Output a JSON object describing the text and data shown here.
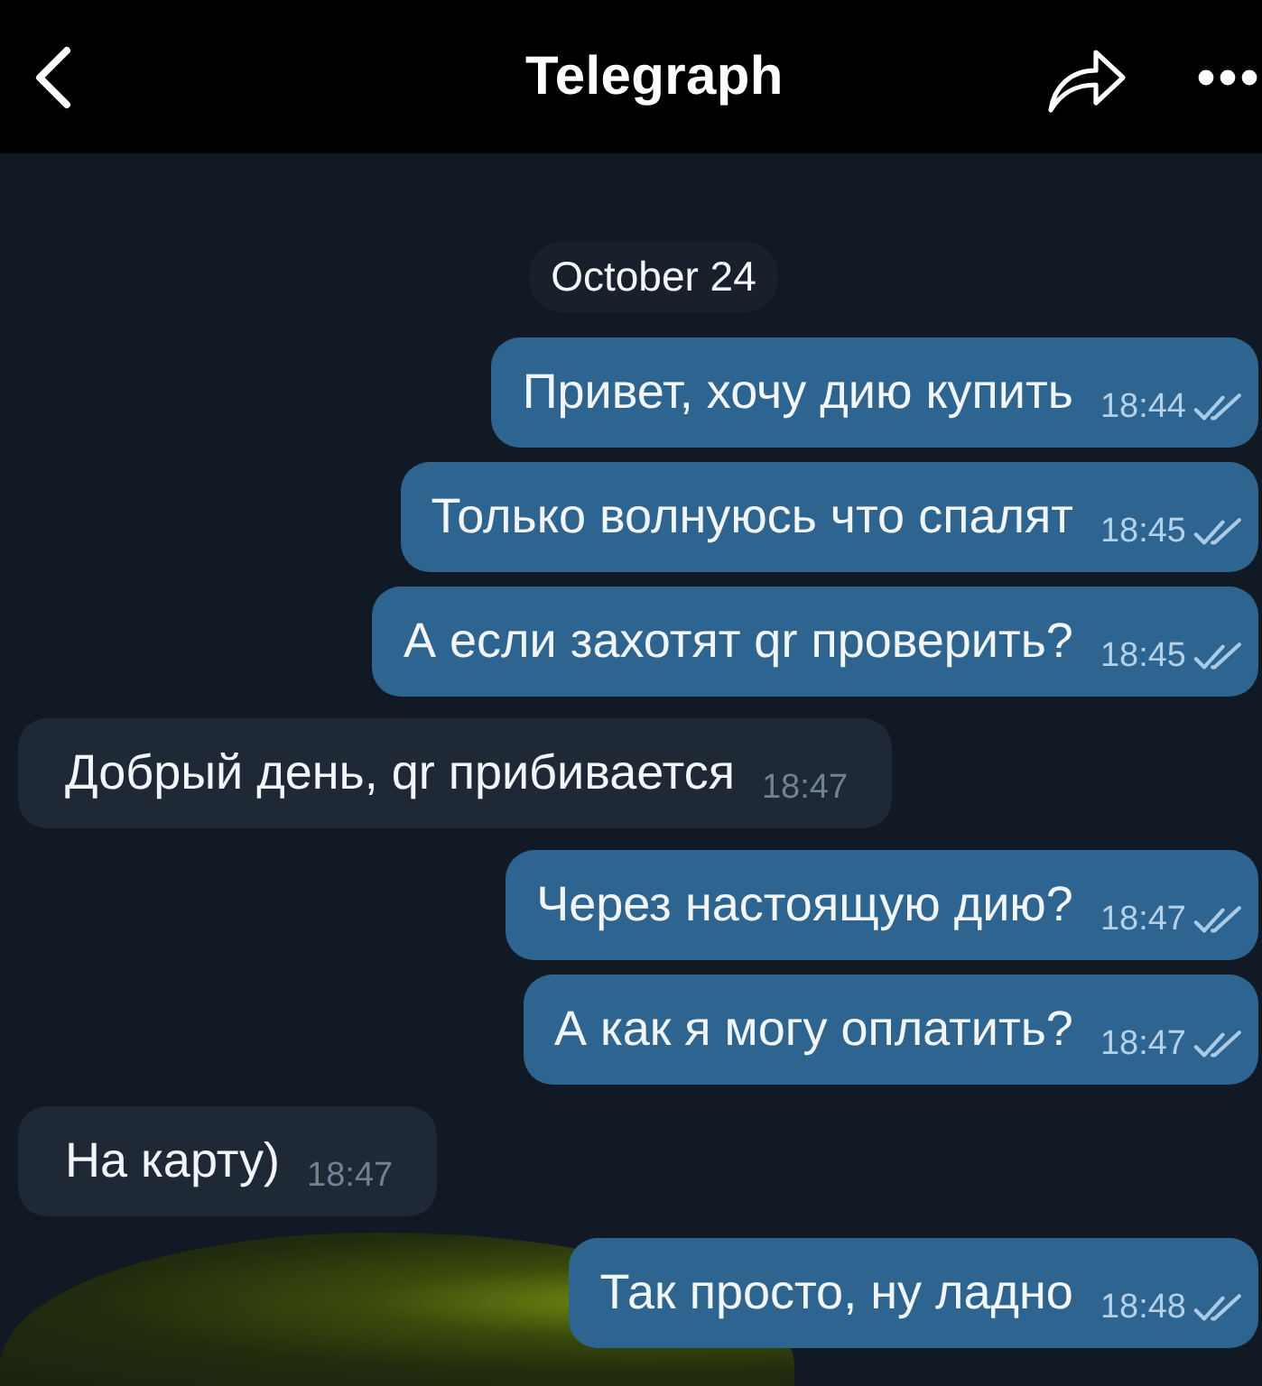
{
  "header": {
    "title": "Telegraph"
  },
  "chat": {
    "date": "October 24",
    "messages": [
      {
        "kind": "outgoing",
        "text": "Привет, хочу дию купить",
        "time": "18:44",
        "read": true
      },
      {
        "kind": "outgoing",
        "text": "Только волнуюсь что спалят",
        "time": "18:45",
        "read": true
      },
      {
        "kind": "outgoing",
        "text": "А если захотят qr проверить?",
        "time": "18:45",
        "read": true
      },
      {
        "kind": "incoming",
        "text": "Добрый день, qr прибивается",
        "time": "18:47"
      },
      {
        "kind": "outgoing",
        "text": "Через настоящую дию?",
        "time": "18:47",
        "read": true
      },
      {
        "kind": "outgoing",
        "text": "А как я могу оплатить?",
        "time": "18:47",
        "read": true
      },
      {
        "kind": "incoming",
        "text": "На карту)",
        "time": "18:47"
      },
      {
        "kind": "outgoing",
        "text": "Так просто, ну ладно",
        "time": "18:48",
        "read": true
      }
    ]
  }
}
